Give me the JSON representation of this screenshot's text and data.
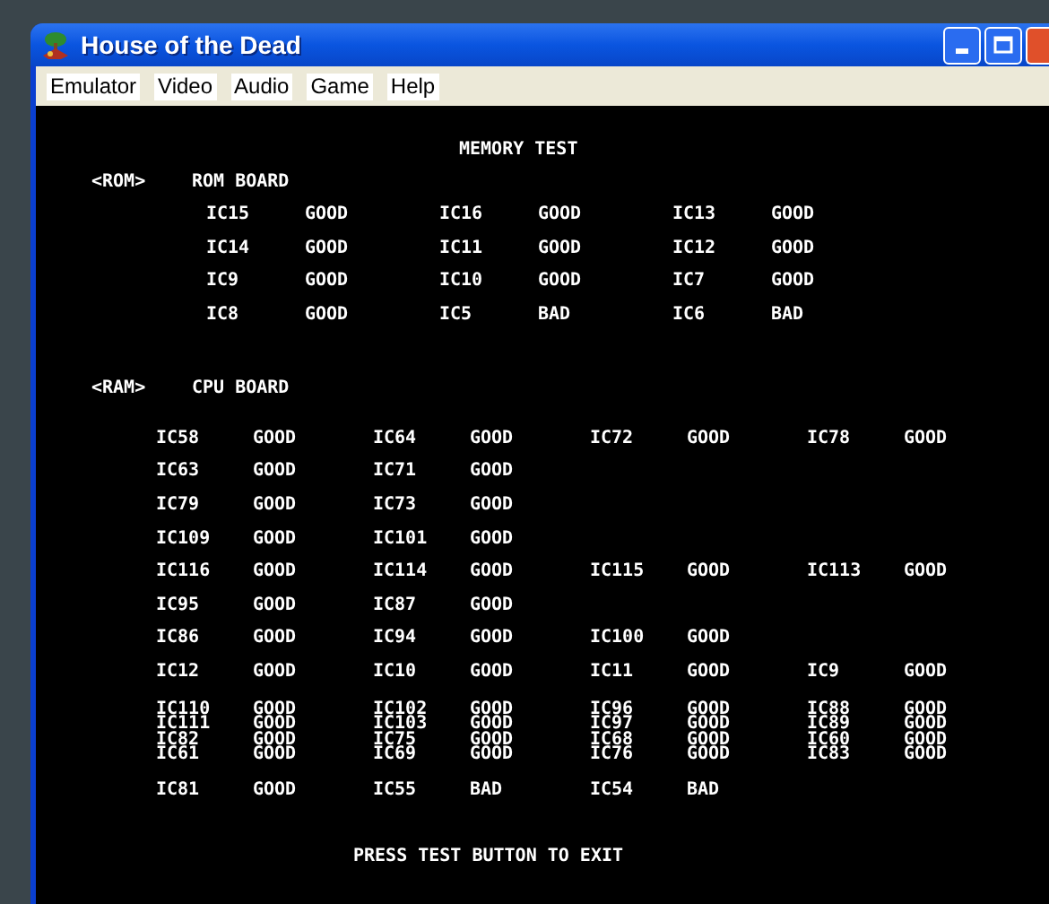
{
  "window": {
    "title": "House of the Dead"
  },
  "menu": [
    "Emulator",
    "Video",
    "Audio",
    "Game",
    "Help"
  ],
  "screen": {
    "title": "MEMORY TEST",
    "rom": {
      "tag": "<ROM>",
      "label": "ROM BOARD",
      "rows": [
        {
          "cells": [
            {
              "ic": "IC15",
              "status": "GOOD"
            },
            {
              "ic": "IC16",
              "status": "GOOD"
            },
            {
              "ic": "IC13",
              "status": "GOOD"
            }
          ]
        },
        {
          "cells": [
            {
              "ic": "IC14",
              "status": "GOOD"
            },
            {
              "ic": "IC11",
              "status": "GOOD"
            },
            {
              "ic": "IC12",
              "status": "GOOD"
            }
          ]
        },
        {
          "cells": [
            {
              "ic": "IC9",
              "status": "GOOD"
            },
            {
              "ic": "IC10",
              "status": "GOOD"
            },
            {
              "ic": "IC7",
              "status": "GOOD"
            }
          ]
        },
        {
          "cells": [
            {
              "ic": "IC8",
              "status": "GOOD"
            },
            {
              "ic": "IC5",
              "status": "BAD"
            },
            {
              "ic": "IC6",
              "status": "BAD"
            }
          ]
        }
      ]
    },
    "ram": {
      "tag": "<RAM>",
      "label": "CPU BOARD",
      "rows": [
        {
          "kind": "line",
          "cells": [
            {
              "ic": "IC58",
              "status": "GOOD"
            },
            {
              "ic": "IC64",
              "status": "GOOD"
            },
            {
              "ic": "IC72",
              "status": "GOOD"
            },
            {
              "ic": "IC78",
              "status": "GOOD"
            }
          ]
        },
        {
          "kind": "line",
          "cells": [
            {
              "ic": "IC63",
              "status": "GOOD"
            },
            {
              "ic": "IC71",
              "status": "GOOD"
            }
          ]
        },
        {
          "kind": "line",
          "cells": [
            {
              "ic": "IC79",
              "status": "GOOD"
            },
            {
              "ic": "IC73",
              "status": "GOOD"
            }
          ]
        },
        {
          "kind": "line",
          "cells": [
            {
              "ic": "IC109",
              "status": "GOOD"
            },
            {
              "ic": "IC101",
              "status": "GOOD"
            }
          ]
        },
        {
          "kind": "line",
          "cells": [
            {
              "ic": "IC116",
              "status": "GOOD"
            },
            {
              "ic": "IC114",
              "status": "GOOD"
            },
            {
              "ic": "IC115",
              "status": "GOOD"
            },
            {
              "ic": "IC113",
              "status": "GOOD"
            }
          ]
        },
        {
          "kind": "line",
          "cells": [
            {
              "ic": "IC95",
              "status": "GOOD"
            },
            {
              "ic": "IC87",
              "status": "GOOD"
            }
          ]
        },
        {
          "kind": "line",
          "cells": [
            {
              "ic": "IC86",
              "status": "GOOD"
            },
            {
              "ic": "IC94",
              "status": "GOOD"
            },
            {
              "ic": "IC100",
              "status": "GOOD"
            }
          ]
        },
        {
          "kind": "line",
          "cells": [
            {
              "ic": "IC12",
              "status": "GOOD"
            },
            {
              "ic": "IC10",
              "status": "GOOD"
            },
            {
              "ic": "IC11",
              "status": "GOOD"
            },
            {
              "ic": "IC9",
              "status": "GOOD"
            }
          ]
        },
        {
          "kind": "squeezed",
          "cells": [
            {
              "ic": "IC110",
              "status": "GOOD"
            },
            {
              "ic": "IC102",
              "status": "GOOD"
            },
            {
              "ic": "IC96",
              "status": "GOOD"
            },
            {
              "ic": "IC88",
              "status": "GOOD"
            }
          ]
        },
        {
          "kind": "squeezed",
          "cells": [
            {
              "ic": "IC111",
              "status": "GOOD"
            },
            {
              "ic": "IC103",
              "status": "GOOD"
            },
            {
              "ic": "IC97",
              "status": "GOOD"
            },
            {
              "ic": "IC89",
              "status": "GOOD"
            }
          ]
        },
        {
          "kind": "squeezed",
          "cells": [
            {
              "ic": "IC82",
              "status": "GOOD"
            },
            {
              "ic": "IC75",
              "status": "GOOD"
            },
            {
              "ic": "IC68",
              "status": "GOOD"
            },
            {
              "ic": "IC60",
              "status": "GOOD"
            }
          ]
        },
        {
          "kind": "squeezed",
          "cells": [
            {
              "ic": "IC61",
              "status": "GOOD"
            },
            {
              "ic": "IC69",
              "status": "GOOD"
            },
            {
              "ic": "IC76",
              "status": "GOOD"
            },
            {
              "ic": "IC83",
              "status": "GOOD"
            }
          ]
        },
        {
          "kind": "line",
          "cells": [
            {
              "ic": "IC81",
              "status": "GOOD"
            },
            {
              "ic": "IC55",
              "status": "BAD"
            },
            {
              "ic": "IC54",
              "status": "BAD"
            }
          ]
        }
      ]
    },
    "footer": "PRESS TEST BUTTON TO EXIT"
  }
}
